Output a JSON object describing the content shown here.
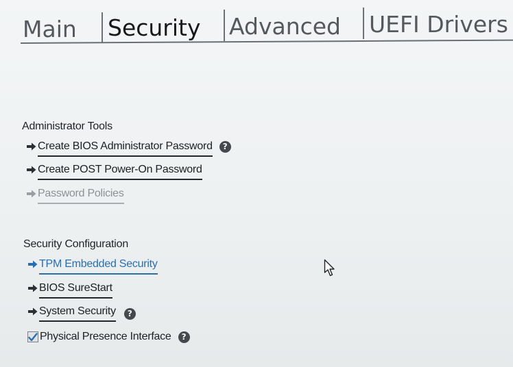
{
  "tabs": [
    {
      "label": "Main",
      "active": false
    },
    {
      "label": "Security",
      "active": true
    },
    {
      "label": "Advanced",
      "active": false
    },
    {
      "label": "UEFI Drivers",
      "active": false
    }
  ],
  "administrator_tools": {
    "title": "Administrator Tools",
    "items": [
      {
        "label": "Create BIOS Administrator Password",
        "icon": "arrow-right-icon",
        "has_help": true,
        "enabled": true
      },
      {
        "label": "Create POST Power-On Password",
        "icon": "arrow-right-icon",
        "has_help": false,
        "enabled": true
      },
      {
        "label": "Password Policies",
        "icon": "arrow-right-icon",
        "has_help": false,
        "enabled": false
      }
    ]
  },
  "security_configuration": {
    "title": "Security Configuration",
    "items": [
      {
        "label": "TPM Embedded Security",
        "icon": "arrow-right-icon",
        "selected": true,
        "has_help": false
      },
      {
        "label": "BIOS SureStart",
        "icon": "arrow-right-icon",
        "selected": false,
        "has_help": false
      },
      {
        "label": "System Security",
        "icon": "arrow-right-icon",
        "selected": false,
        "has_help": true
      }
    ],
    "checkbox": {
      "label": "Physical Presence Interface",
      "checked": true,
      "has_help": true
    }
  },
  "help_glyph": "?",
  "colors": {
    "accent_blue": "#2a6eb0",
    "text_dark": "#1d1f23",
    "disabled_text": "#8d9095",
    "background": "#eef1f2"
  }
}
